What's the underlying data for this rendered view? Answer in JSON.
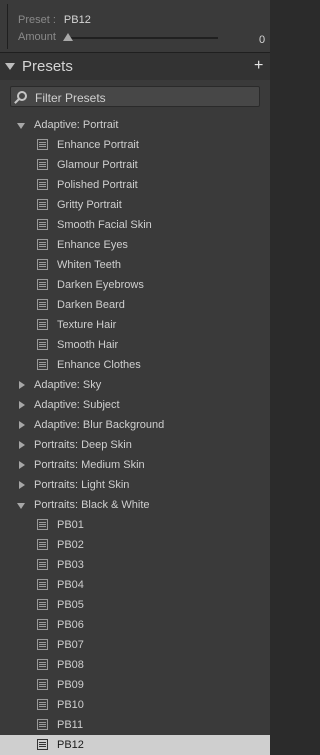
{
  "top": {
    "preset_label": "Preset :",
    "preset_value": "PB12",
    "amount_label": "Amount",
    "amount_value": "0",
    "amount_slider_fraction": 0
  },
  "presets_panel": {
    "title": "Presets",
    "add_icon": "plus-icon",
    "filter_placeholder": "Filter Presets"
  },
  "groups": [
    {
      "label": "Adaptive: Portrait",
      "expanded": true,
      "items": [
        "Enhance Portrait",
        "Glamour Portrait",
        "Polished Portrait",
        "Gritty Portrait",
        "Smooth Facial Skin",
        "Enhance Eyes",
        "Whiten Teeth",
        "Darken Eyebrows",
        "Darken Beard",
        "Texture Hair",
        "Smooth Hair",
        "Enhance Clothes"
      ]
    },
    {
      "label": "Adaptive: Sky",
      "expanded": false,
      "items": []
    },
    {
      "label": "Adaptive: Subject",
      "expanded": false,
      "items": []
    },
    {
      "label": "Adaptive: Blur Background",
      "expanded": false,
      "items": []
    },
    {
      "label": "Portraits: Deep Skin",
      "expanded": false,
      "items": []
    },
    {
      "label": "Portraits: Medium Skin",
      "expanded": false,
      "items": []
    },
    {
      "label": "Portraits: Light Skin",
      "expanded": false,
      "items": []
    },
    {
      "label": "Portraits: Black & White",
      "expanded": true,
      "items": [
        "PB01",
        "PB02",
        "PB03",
        "PB04",
        "PB05",
        "PB06",
        "PB07",
        "PB08",
        "PB09",
        "PB10",
        "PB11",
        "PB12"
      ],
      "selected": "PB12"
    }
  ]
}
